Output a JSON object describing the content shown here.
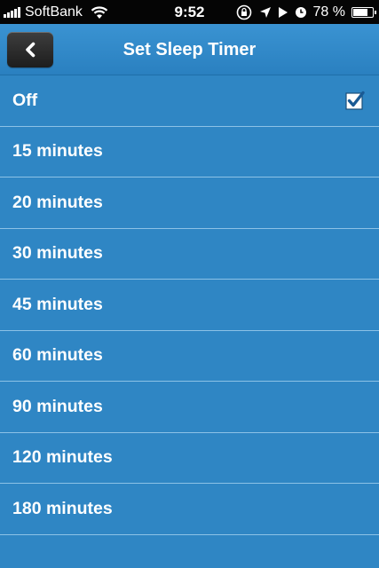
{
  "status_bar": {
    "carrier": "SoftBank",
    "time": "9:52",
    "battery_percent_label": "78 %",
    "battery_level": 0.78,
    "icons": [
      "signal-icon",
      "wifi-icon",
      "rotation-lock-icon",
      "location-icon",
      "play-icon",
      "alarm-icon",
      "battery-icon"
    ]
  },
  "nav": {
    "title": "Set Sleep Timer",
    "back_icon": "chevron-left-icon"
  },
  "options": [
    {
      "label": "Off",
      "selected": true
    },
    {
      "label": "15 minutes",
      "selected": false
    },
    {
      "label": "20 minutes",
      "selected": false
    },
    {
      "label": "30 minutes",
      "selected": false
    },
    {
      "label": "45 minutes",
      "selected": false
    },
    {
      "label": "60 minutes",
      "selected": false
    },
    {
      "label": "90 minutes",
      "selected": false
    },
    {
      "label": "120 minutes",
      "selected": false
    },
    {
      "label": "180 minutes",
      "selected": false
    }
  ],
  "colors": {
    "background": "#2f86c4",
    "status_bar": "#050505",
    "separator": "#8cc2e6",
    "back_button": "#2a2a2a"
  }
}
